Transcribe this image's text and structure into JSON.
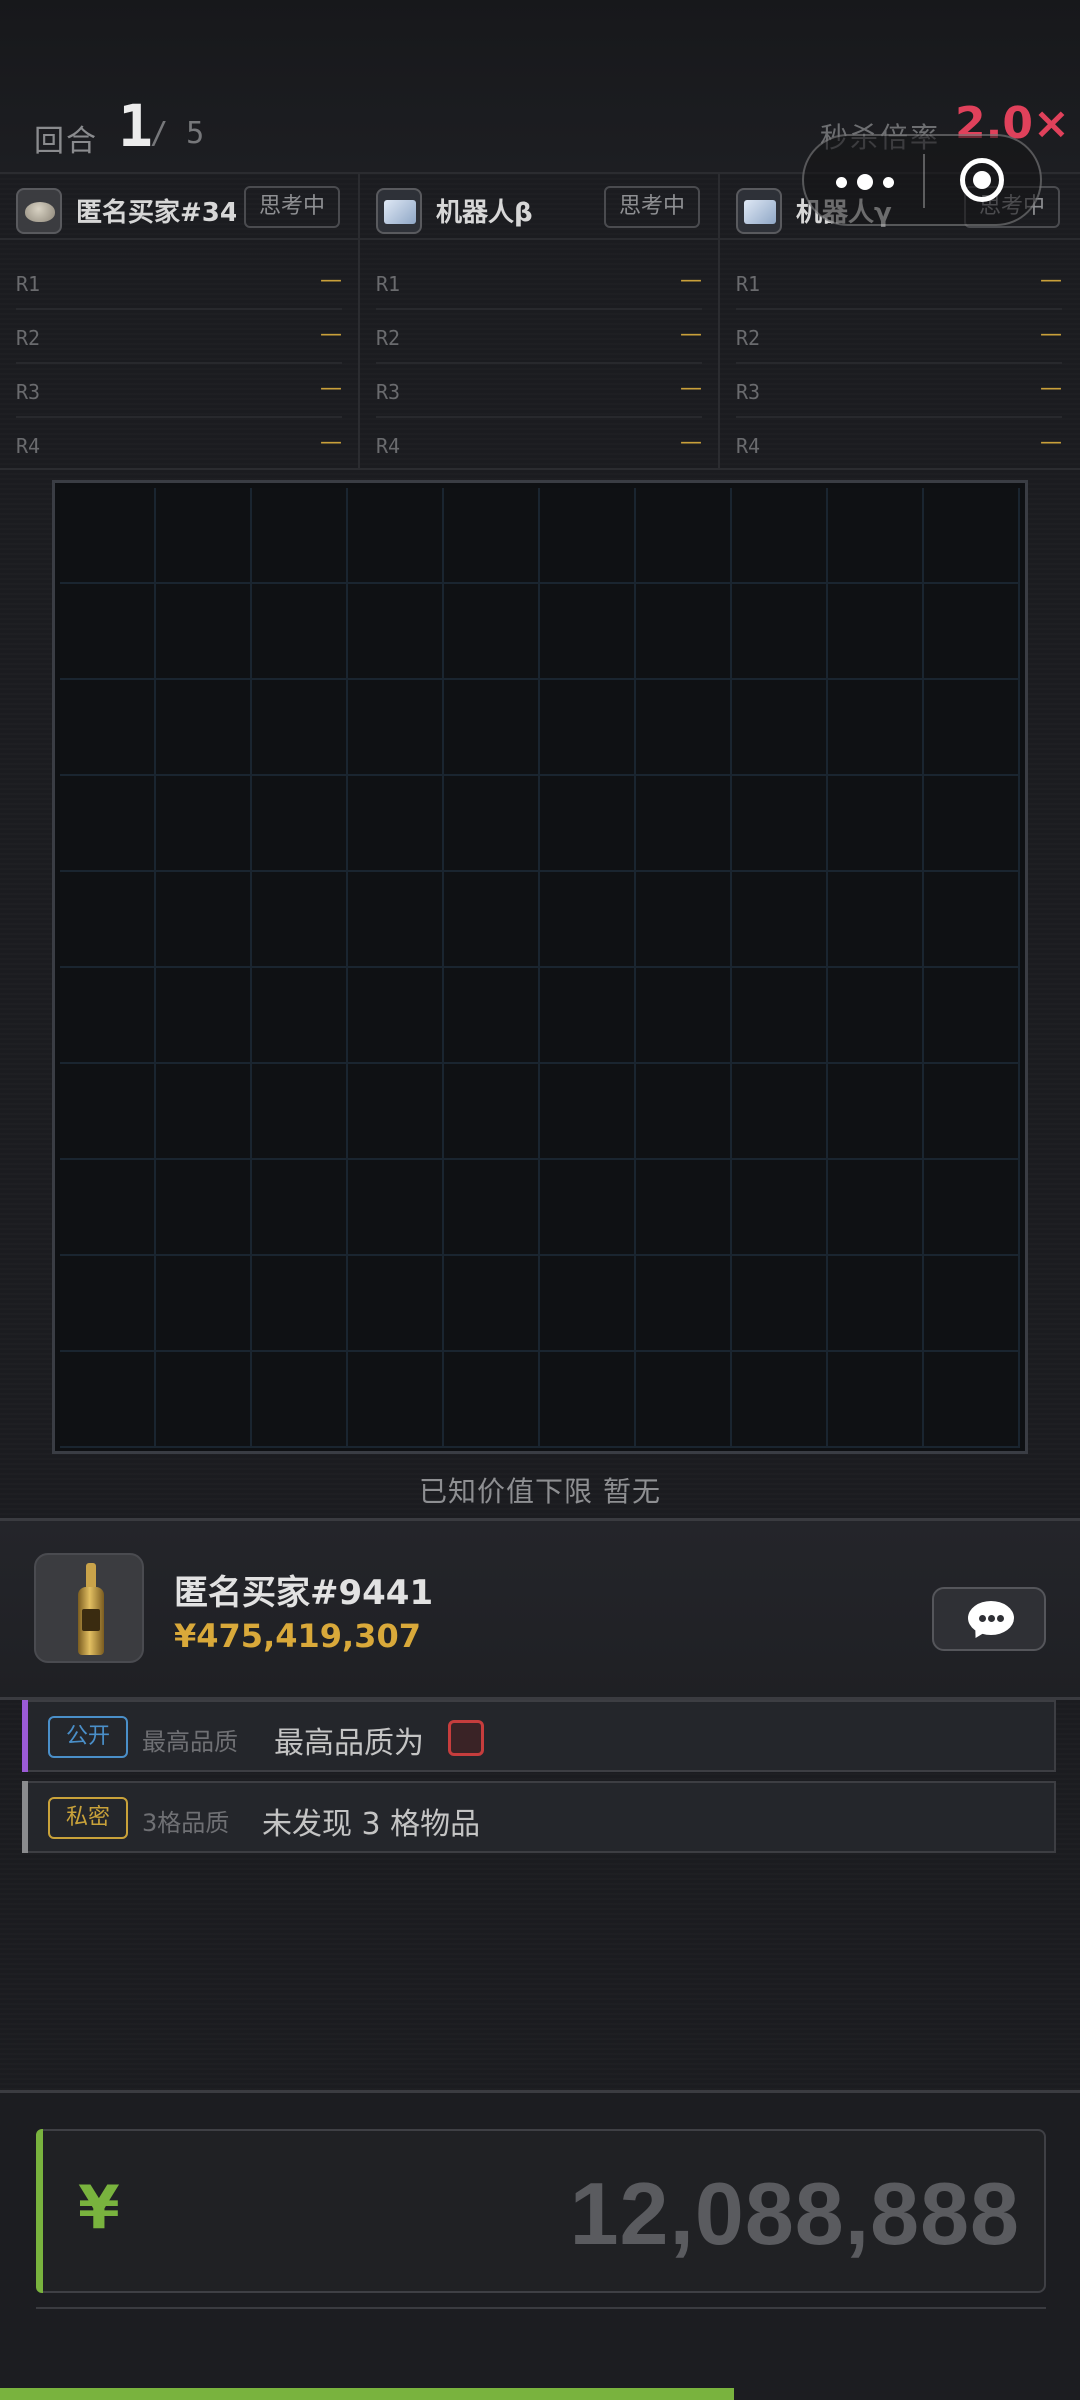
{
  "round": {
    "label": "回合",
    "current": "1",
    "total": "/ 5"
  },
  "multiplier": {
    "label": "秒杀倍率",
    "value": "2.0×"
  },
  "players": [
    {
      "name": "匿名买家#346",
      "status": "思考中",
      "avatar_icon": "bowl-avatar-icon",
      "rounds": [
        {
          "label": "R1",
          "value": "—"
        },
        {
          "label": "R2",
          "value": "—"
        },
        {
          "label": "R3",
          "value": "—"
        },
        {
          "label": "R4",
          "value": "—"
        }
      ]
    },
    {
      "name": "机器人β",
      "status": "思考中",
      "avatar_icon": "robot-screen-icon",
      "rounds": [
        {
          "label": "R1",
          "value": "—"
        },
        {
          "label": "R2",
          "value": "—"
        },
        {
          "label": "R3",
          "value": "—"
        },
        {
          "label": "R4",
          "value": "—"
        }
      ]
    },
    {
      "name": "机器人γ",
      "status": "思考中",
      "avatar_icon": "robot-screen-icon",
      "rounds": [
        {
          "label": "R1",
          "value": "—"
        },
        {
          "label": "R2",
          "value": "—"
        },
        {
          "label": "R3",
          "value": "—"
        },
        {
          "label": "R4",
          "value": "—"
        }
      ]
    }
  ],
  "board": {
    "rows": 10,
    "cols": 10
  },
  "known_value": "已知价值下限 暂无",
  "buyer": {
    "name": "匿名买家#9441",
    "price": "¥475,419,307",
    "item_icon": "champagne-bottle-icon"
  },
  "clues": [
    {
      "tag": "公开",
      "kind": "最高品质",
      "desc": "最高品质为",
      "tag_color": "#4a8fc9",
      "stripe_color": "#9b5bd6"
    },
    {
      "tag": "私密",
      "kind": "3格品质",
      "desc": "未发现 3 格物品",
      "tag_color": "#c9a23a",
      "stripe_color": "#8a8b8e"
    }
  ],
  "bid": {
    "currency": "¥",
    "amount": "12,088,888"
  },
  "timer_progress": 0.68,
  "colors": {
    "accent_green": "#79b33e",
    "gold": "#d9a93a",
    "multiplier_red": "#e0415b"
  }
}
